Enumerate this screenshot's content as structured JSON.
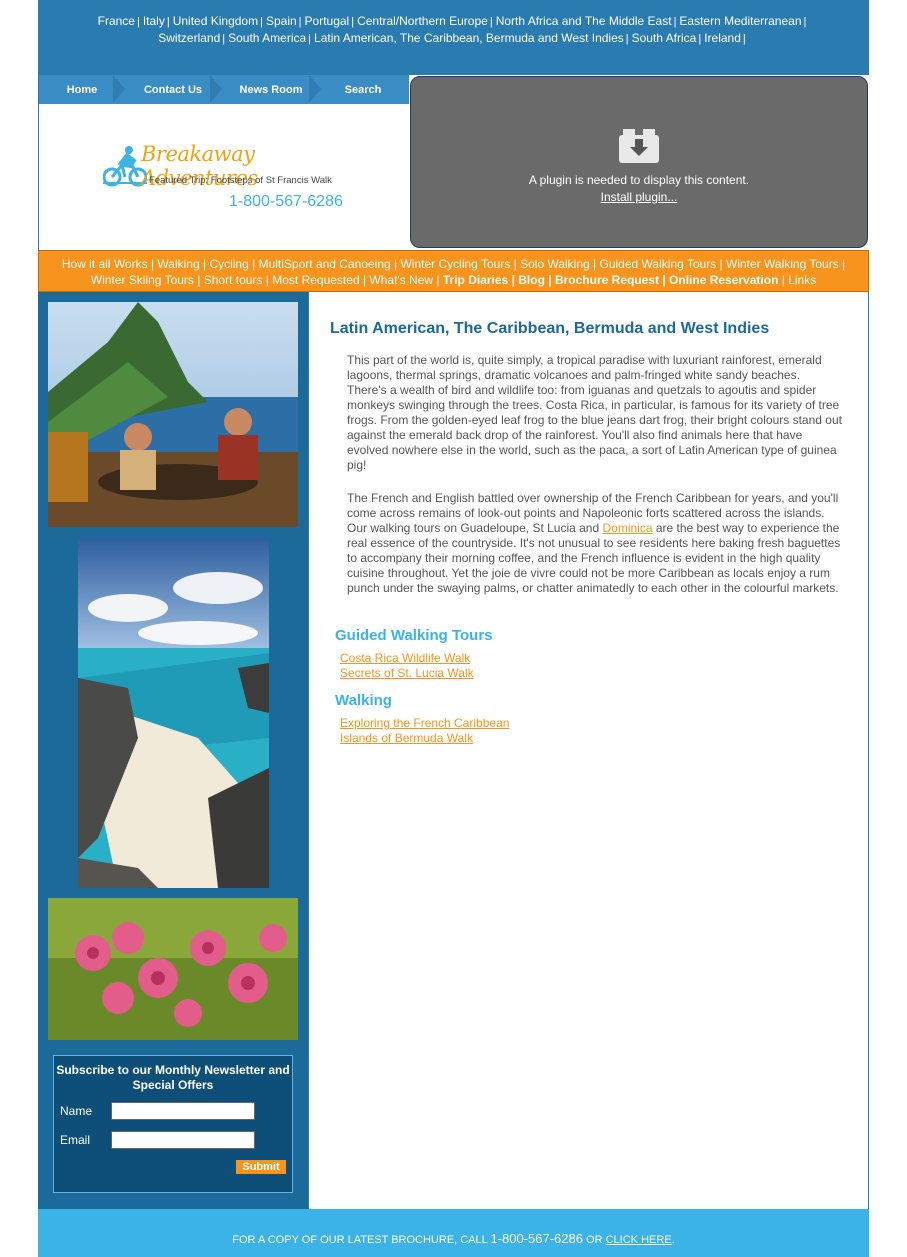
{
  "countries": [
    "France",
    "Italy",
    "United Kingdom",
    "Spain",
    "Portugal",
    "Central/Northern Europe",
    "North Africa and The Middle East",
    "Eastern Mediterranean",
    "Switzerland",
    "South America",
    "Latin American, The Caribbean, Bermuda and West Indies",
    "South Africa",
    "Ireland"
  ],
  "nav": {
    "home": "Home",
    "contact": "Contact Us",
    "news": "News Room",
    "search": "Search"
  },
  "logo": {
    "name": "Breakaway Adventures",
    "featured": "Featured Trip: Footsteps of St Francis Walk",
    "phone": "1-800-567-6286"
  },
  "plugin": {
    "message": "A plugin is needed to display this content.",
    "link": "Install plugin..."
  },
  "menu": [
    {
      "label": "How it all Works",
      "bold": false
    },
    {
      "label": "Walking",
      "bold": false
    },
    {
      "label": "Cycling",
      "bold": false
    },
    {
      "label": "MultiSport and Canoeing",
      "bold": false
    },
    {
      "label": "Winter Cycling Tours",
      "bold": false
    },
    {
      "label": "Solo Walking",
      "bold": false
    },
    {
      "label": "Guided Walking Tours",
      "bold": false
    },
    {
      "label": "Winter Walking Tours",
      "bold": false
    },
    {
      "label": "Winter Skiing Tours",
      "bold": false
    },
    {
      "label": "Short tours",
      "bold": false
    },
    {
      "label": "Most Requested",
      "bold": false
    },
    {
      "label": "What's New",
      "bold": false
    },
    {
      "label": "Trip Diaries",
      "bold": true
    },
    {
      "label": "Blog",
      "bold": true
    },
    {
      "label": "Brochure Request",
      "bold": true
    },
    {
      "label": "Online Reservation",
      "bold": true
    },
    {
      "label": "Links",
      "bold": false
    }
  ],
  "newsletter": {
    "title": "Subscribe to our Monthly Newsletter and Special Offers",
    "name_label": "Name",
    "email_label": "Email",
    "name_value": "",
    "email_value": "",
    "submit": "Submit"
  },
  "main": {
    "title": "Latin American, The Caribbean, Bermuda and West Indies",
    "para1": "This part of the world is, quite simply, a tropical paradise with luxuriant rainforest, emerald lagoons, thermal springs, dramatic volcanoes and palm-fringed white sandy beaches. There's a wealth of bird and wildlife too: from iguanas and quetzals to agoutis and spider monkeys swinging through the trees. Costa Rica, in particular, is famous for its variety of tree frogs. From the golden-eyed leaf frog to the blue jeans dart frog, their bright colours stand out against the emerald back drop of the rainforest. You'll also find animals here that have evolved nowhere else in the world, such as the paca, a sort of Latin American type of guinea pig!",
    "para2_before": "The French and English battled over ownership of the French Caribbean for years, and you'll come across remains of look-out points and Napoleonic forts scattered across the islands. Our walking tours on Guadeloupe, St Lucia and ",
    "para2_link": "Dominica",
    "para2_after": " are the best way to experience the real essence of the countryside. It's not unusual to see residents here baking fresh baguettes to accompany their morning coffee, and the French influence is evident in the high quality cuisine throughout. Yet the joie de vivre could not be more Caribbean as locals enjoy a rum punch under the swaying palms, or chatter animatedly to each other in the colourful markets.",
    "sections": [
      {
        "heading": "Guided Walking Tours",
        "tours": [
          "Costa Rica Wildlife Walk",
          "Secrets of St. Lucia Walk"
        ]
      },
      {
        "heading": "Walking",
        "tours": [
          "Exploring the French Caribbean",
          "Islands of Bermuda Walk"
        ]
      }
    ]
  },
  "footer": {
    "text": "FOR A COPY OF OUR LATEST BROCHURE, CALL",
    "phone": "1-800-567-6286",
    "or": "OR",
    "link": "CLICK HERE",
    "end": "."
  },
  "colors": {
    "topbar": "#2a7cb0",
    "orange": "#f7941d",
    "leftcol": "#1b6a9a",
    "footer": "#3cb3e6",
    "title": "#1b6a9a"
  }
}
